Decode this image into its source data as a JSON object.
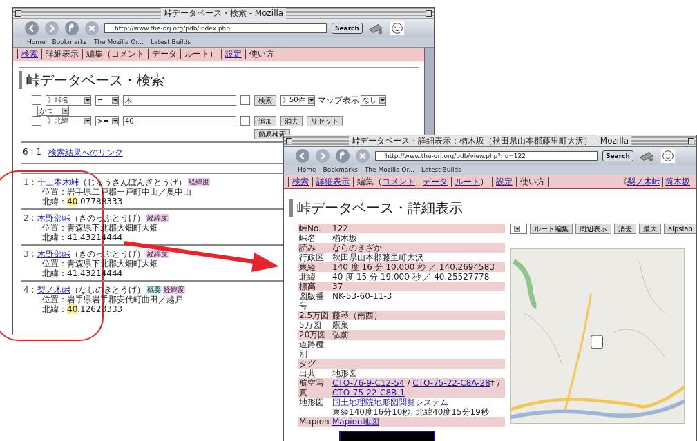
{
  "windows": [
    {
      "kind": "search",
      "title": "峠データベース・検索 - Mozilla",
      "url": "http://www.the-orj.org/pdb/index.php",
      "search_button": "Search",
      "bookmarks": [
        "Home",
        "Bookmarks",
        "The Mozilla Or...",
        "Latest Builds"
      ],
      "nav": [
        {
          "parts": [
            {
              "text": "検索",
              "link": true
            }
          ]
        },
        {
          "parts": [
            {
              "text": "詳細表示",
              "link": false
            }
          ]
        },
        {
          "parts": [
            {
              "text": "編集（コメント",
              "link": false
            }
          ]
        },
        {
          "parts": [
            {
              "text": "データ",
              "link": false
            }
          ]
        },
        {
          "parts": [
            {
              "text": "ルート）",
              "link": false
            }
          ]
        },
        {
          "parts": [
            {
              "text": "設定",
              "link": true
            }
          ]
        },
        {
          "parts": [
            {
              "text": "使い方",
              "link": false
            }
          ]
        }
      ],
      "heading": "峠データベース・検索",
      "conditions": [
        {
          "enabled": false,
          "field": "》峠名",
          "operator": "=",
          "value": "木",
          "flag": false,
          "controls": [
            {
              "kind": "button",
              "text": "検索"
            },
            {
              "kind": "select",
              "text": "》50件"
            },
            {
              "kind": "label",
              "text": "マップ表示"
            },
            {
              "kind": "select",
              "text": "なし"
            }
          ]
        },
        {
          "enabled": false,
          "field": "》北緯",
          "operator": ">=",
          "value": "40",
          "flag": false,
          "controls": [
            {
              "kind": "button",
              "text": "追加"
            },
            {
              "kind": "button",
              "text": "消去"
            },
            {
              "kind": "button",
              "text": "リセット"
            }
          ]
        }
      ],
      "conjunction": "かつ",
      "simple_search_button": "簡易検索",
      "summary": {
        "count": "6 : 1",
        "link": "検索結果へのリンク"
      },
      "results": [
        {
          "index": "1 :",
          "name": "十三本木峠",
          "reading": "（じゅうさんぼんぎとうげ）",
          "tags": [
            {
              "text": "経緯度",
              "color": "#f0c8f0"
            }
          ],
          "location": "位置：岩手県二戸郡一戸町中山／奥中山",
          "latitude": [
            {
              "text": "北緯：",
              "highlighted": false
            },
            {
              "text": "40",
              "highlighted": true
            },
            {
              "text": ".07788333",
              "highlighted": false
            }
          ]
        },
        {
          "index": "2 :",
          "name": "木野部峠",
          "reading": "（きのっぷとうげ）",
          "tags": [
            {
              "text": "経緯度",
              "color": "#f0c8f0"
            }
          ],
          "location": "位置：青森県下北郡大畑町大畑",
          "latitude": [
            {
              "text": "北緯：41.43214444",
              "highlighted": false
            }
          ]
        },
        {
          "index": "3 :",
          "name": "木野部峠",
          "reading": "（きのっぷとうげ）",
          "tags": [
            {
              "text": "経緯度",
              "color": "#f0c8f0"
            }
          ],
          "location": "位置：青森県下北郡大畑町大畑",
          "latitude": [
            {
              "text": "北緯：41.43214444",
              "highlighted": false
            }
          ]
        },
        {
          "index": "4 :",
          "name": "梨ノ木峠",
          "reading": "（なしのきとうげ）",
          "tags": [
            {
              "text": "概要",
              "color": "#c8f0f0"
            },
            {
              "text": "経緯度",
              "color": "#f0c8f0"
            }
          ],
          "location": "位置：岩手県岩手郡安代町曲田／越戸",
          "latitude": [
            {
              "text": "北緯：",
              "highlighted": false
            },
            {
              "text": "40",
              "highlighted": true
            },
            {
              "text": ".12623333",
              "highlighted": false
            }
          ]
        }
      ]
    },
    {
      "kind": "detail",
      "title": "峠データベース・詳細表示：楢木坂（秋田県山本郡藤里町大沢） - Mozilla",
      "url": "http://www.the-orj.org/pdb/view.php?no=122",
      "search_button": "Search",
      "bookmarks": [
        "Home",
        "Bookmarks",
        "The Mozilla Or...",
        "Latest Builds"
      ],
      "nav": [
        {
          "parts": [
            {
              "text": "検索",
              "link": true
            }
          ]
        },
        {
          "parts": [
            {
              "text": "詳細表示",
              "link": true
            }
          ]
        },
        {
          "parts": [
            {
              "text": "編集（",
              "link": false
            },
            {
              "text": "コメント",
              "link": true
            }
          ]
        },
        {
          "parts": [
            {
              "text": "データ",
              "link": true
            }
          ]
        },
        {
          "parts": [
            {
              "text": "ルート",
              "link": true
            },
            {
              "text": "）",
              "link": false
            }
          ]
        },
        {
          "parts": [
            {
              "text": "設定",
              "link": true
            }
          ]
        },
        {
          "parts": [
            {
              "text": "使い方",
              "link": false
            }
          ]
        }
      ],
      "nav_right": [
        {
          "parts": [
            {
              "text": "《",
              "link": false
            },
            {
              "text": "梨ノ木峠",
              "link": true
            }
          ]
        },
        {
          "parts": [
            {
              "text": "筒木坂",
              "link": true
            }
          ]
        }
      ],
      "heading": "峠データベース・詳細表示",
      "map_buttons": [
        "ルート編集",
        "周辺表示",
        "消去",
        "最大",
        "alpslab"
      ],
      "details": [
        {
          "label": "峠No.",
          "lines": [
            [
              {
                "text": "122",
                "link": false
              }
            ]
          ]
        },
        {
          "label": "峠名",
          "lines": [
            [
              {
                "text": "楢木坂",
                "link": false
              }
            ]
          ]
        },
        {
          "label": "読み",
          "lines": [
            [
              {
                "text": "ならのきざか",
                "link": false
              }
            ]
          ]
        },
        {
          "label": "行政区",
          "lines": [
            [
              {
                "text": "秋田県山本郡藤里町大沢",
                "link": false
              }
            ]
          ]
        },
        {
          "label": "東経",
          "lines": [
            [
              {
                "text": "140 度 16 分 10.000 秒 ／ 140.2694583",
                "link": false
              }
            ]
          ]
        },
        {
          "label": "北緯",
          "lines": [
            [
              {
                "text": "40 度 15 分 19.000 秒 ／ 40.25527778",
                "link": false
              }
            ]
          ]
        },
        {
          "label": "標高",
          "lines": [
            [
              {
                "text": "37",
                "link": false
              }
            ]
          ]
        },
        {
          "label": "図版番号",
          "lines": [
            [
              {
                "text": "NK-53-60-11-3",
                "link": false
              }
            ]
          ]
        },
        {
          "label": "2.5万図",
          "lines": [
            [
              {
                "text": "藤琴（南西）",
                "link": false
              }
            ]
          ]
        },
        {
          "label": "5万図",
          "lines": [
            [
              {
                "text": "鷹巣",
                "link": false
              }
            ]
          ]
        },
        {
          "label": "20万図",
          "lines": [
            [
              {
                "text": "弘前",
                "link": false
              }
            ]
          ]
        },
        {
          "label": "道路種別"
        },
        {
          "label": "タグ"
        },
        {
          "label": "出典",
          "lines": [
            [
              {
                "text": "地形図",
                "link": false
              }
            ]
          ]
        },
        {
          "label": "航空写真",
          "lines": [
            [
              {
                "text": "CTO-76-9-C12-54",
                "link": true
              },
              {
                "text": " / ",
                "link": false
              },
              {
                "text": "CTO-75-22-C8A-28",
                "link": true
              },
              {
                "text": "† / ",
                "link": false
              },
              {
                "text": "CTO-75-22-C8B-1",
                "link": true
              }
            ]
          ]
        },
        {
          "label": "地形図",
          "lines": [
            [
              {
                "text": "国土地理院地形図閲覧システム",
                "link": true
              }
            ],
            [
              {
                "text": "東経140度16分10秒, 北緯40度15分19秒",
                "link": false
              }
            ]
          ]
        },
        {
          "label": "Mapion",
          "lines": [
            [
              {
                "text": "Mapion地図",
                "link": true
              }
            ]
          ]
        }
      ]
    }
  ]
}
